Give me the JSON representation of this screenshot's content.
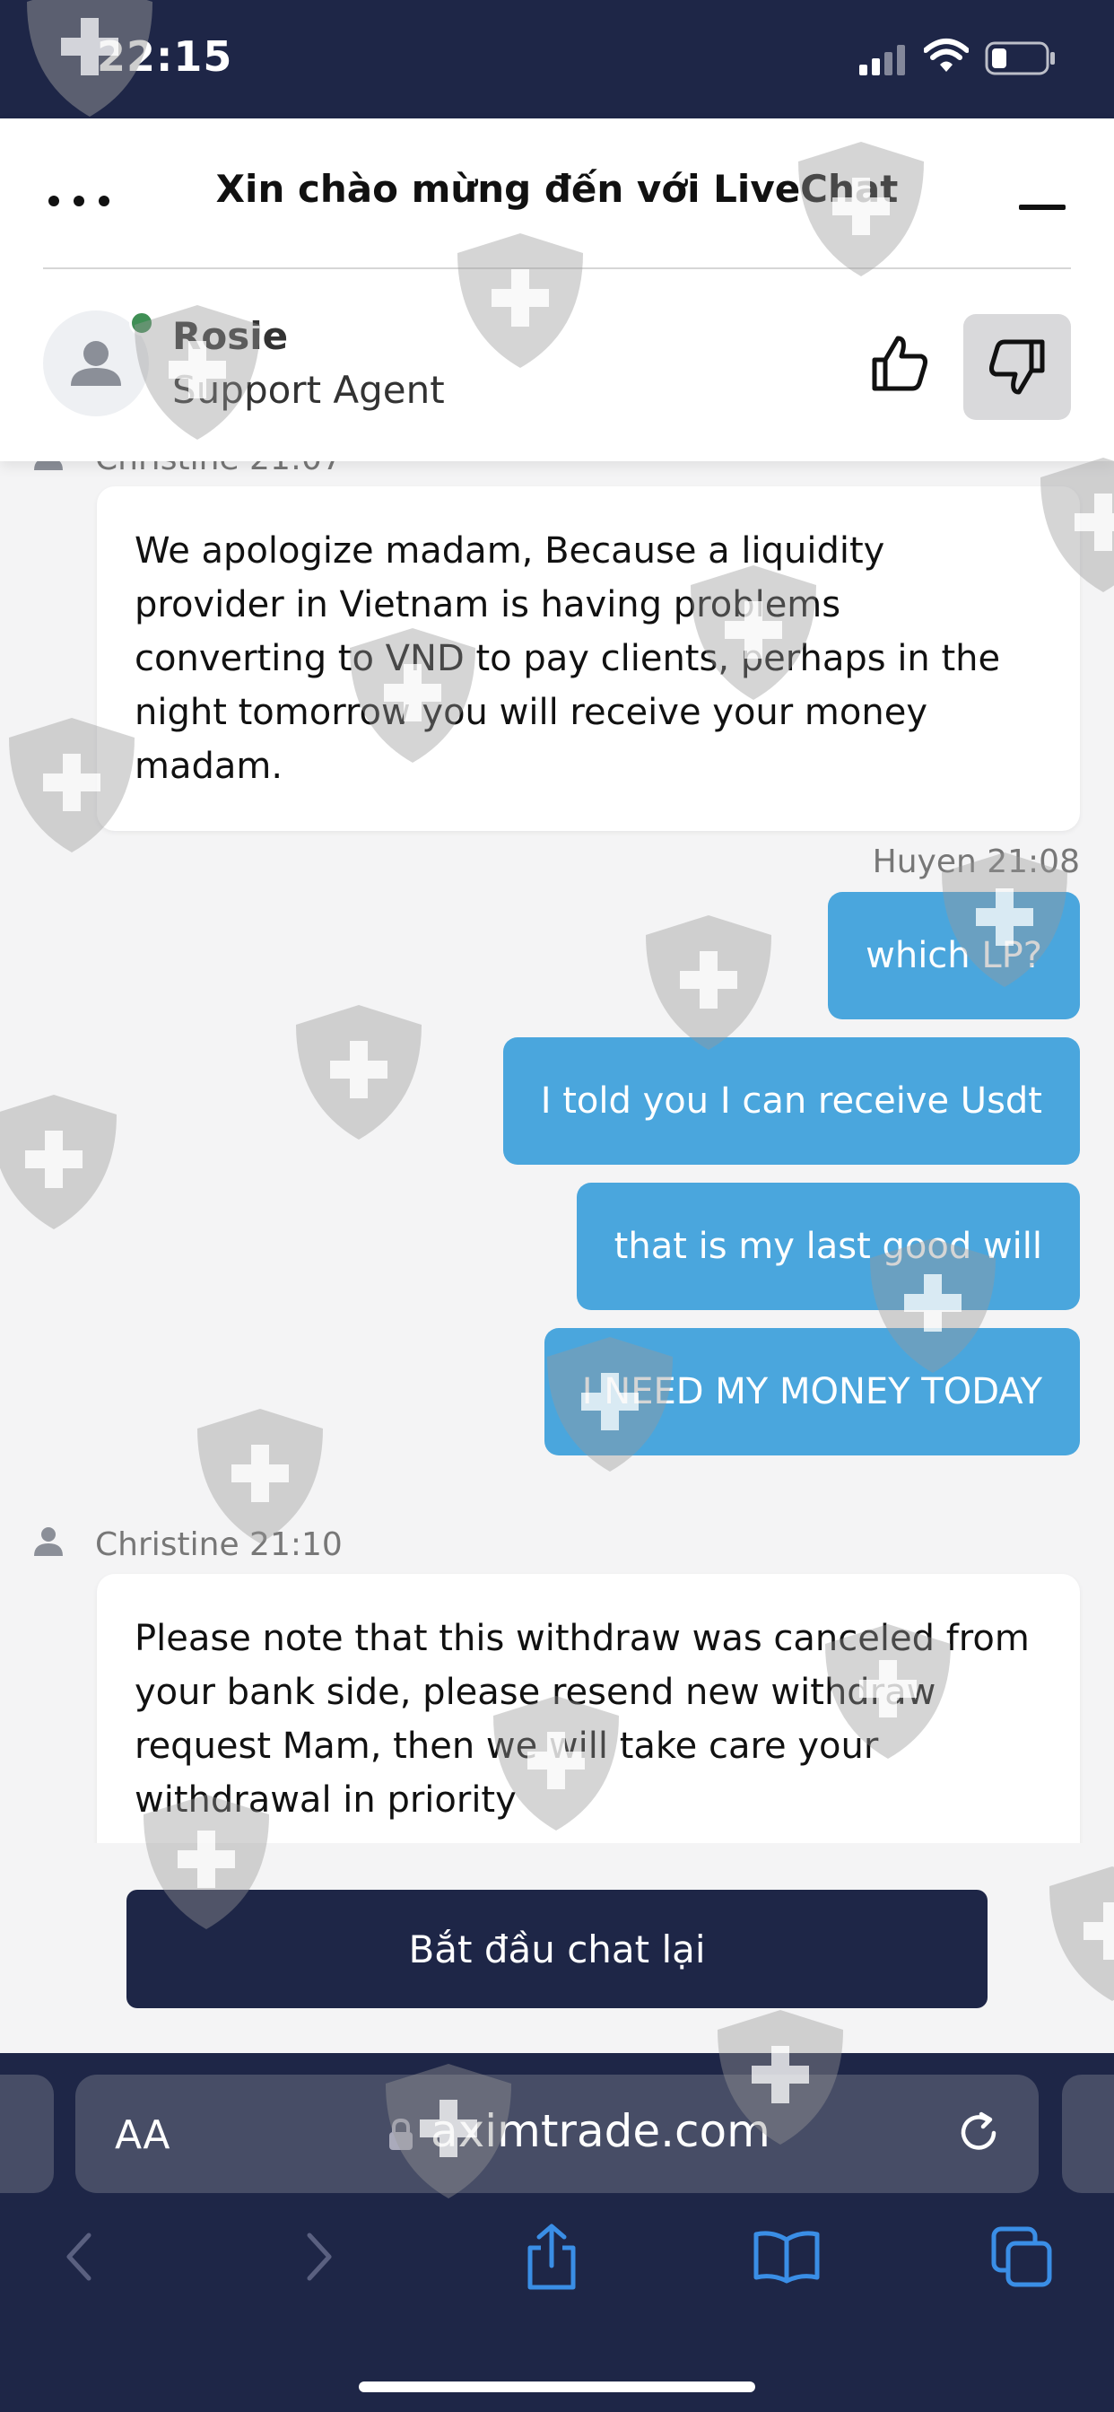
{
  "status_bar": {
    "time": "22:15"
  },
  "header": {
    "title": "Xin chào mừng đến với LiveChat",
    "agent_name": "Rosie",
    "agent_role": "Support Agent"
  },
  "messages": {
    "top_meta": "Christine 21:07",
    "msg1": "We apologize madam, Because a liquidity provider in Vietnam is having problems converting to VND to pay clients, perhaps in the night tomorrow you will receive your money madam.",
    "user_meta": "Huyen 21:08",
    "user1": "which LP?",
    "user2": "I told you I can receive Usdt",
    "user3": "that is my last good will",
    "user4": "I NEED MY MONEY TODAY",
    "agent_meta": "Christine 21:10",
    "msg2": "Please note that this withdraw was canceled from your bank side, please resend new withdraw request Mam, then we will take care your withdrawal in priority"
  },
  "restart_button": "Bắt đầu chat lại",
  "browser": {
    "text_size_label": "AA",
    "url": "aximtrade.com"
  },
  "colors": {
    "navy": "#1e2647",
    "user_bubble": "#4aa6dd",
    "online": "#3f8f55"
  }
}
